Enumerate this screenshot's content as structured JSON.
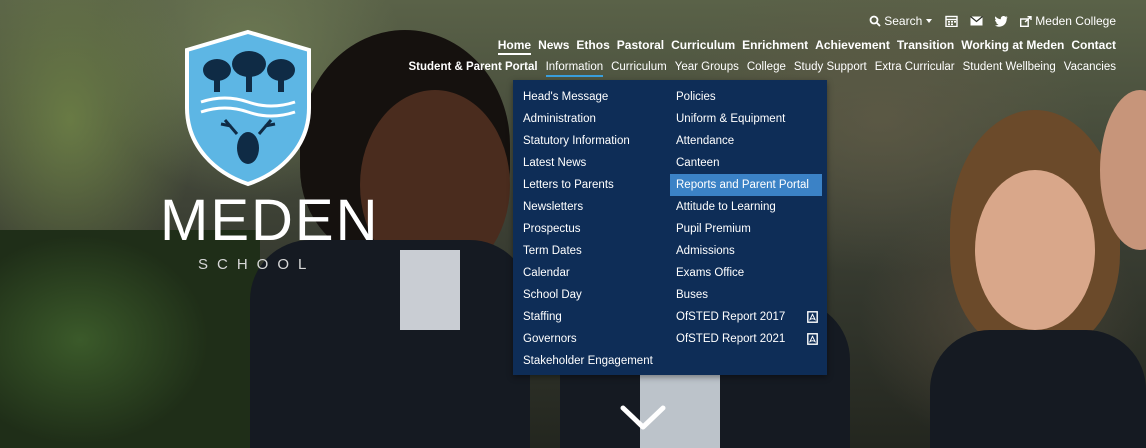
{
  "logo": {
    "word": "MEDEN",
    "sub": "SCHOOL"
  },
  "utility": {
    "search_label": "Search",
    "college_label": "Meden College",
    "icons": [
      "search-icon",
      "caret-down-icon",
      "calendar-icon",
      "mail-icon",
      "twitter-icon",
      "external-link-icon"
    ]
  },
  "mainnav": [
    "Home",
    "News",
    "Ethos",
    "Pastoral",
    "Curriculum",
    "Enrichment",
    "Achievement",
    "Transition",
    "Working at Meden",
    "Contact"
  ],
  "subnav": [
    "Student & Parent Portal",
    "Information",
    "Curriculum",
    "Year Groups",
    "College",
    "Study Support",
    "Extra Curricular",
    "Student Wellbeing",
    "Vacancies"
  ],
  "dropdown": {
    "col1": [
      "Head's Message",
      "Administration",
      "Statutory Information",
      "Latest News",
      "Letters to Parents",
      "Newsletters",
      "Prospectus",
      "Term Dates",
      "Calendar",
      "School Day",
      "Staffing",
      "Governors",
      "Stakeholder Engagement"
    ],
    "col2": [
      "Policies",
      "Uniform & Equipment",
      "Attendance",
      "Canteen",
      "Reports and Parent Portal",
      "Attitude to Learning",
      "Pupil Premium",
      "Admissions",
      "Exams Office",
      "Buses",
      "OfSTED Report 2017",
      "OfSTED Report 2021"
    ]
  },
  "colors": {
    "menu_bg": "#0e2d57",
    "highlight": "#3b82c6",
    "crest": "#5db6e4"
  }
}
